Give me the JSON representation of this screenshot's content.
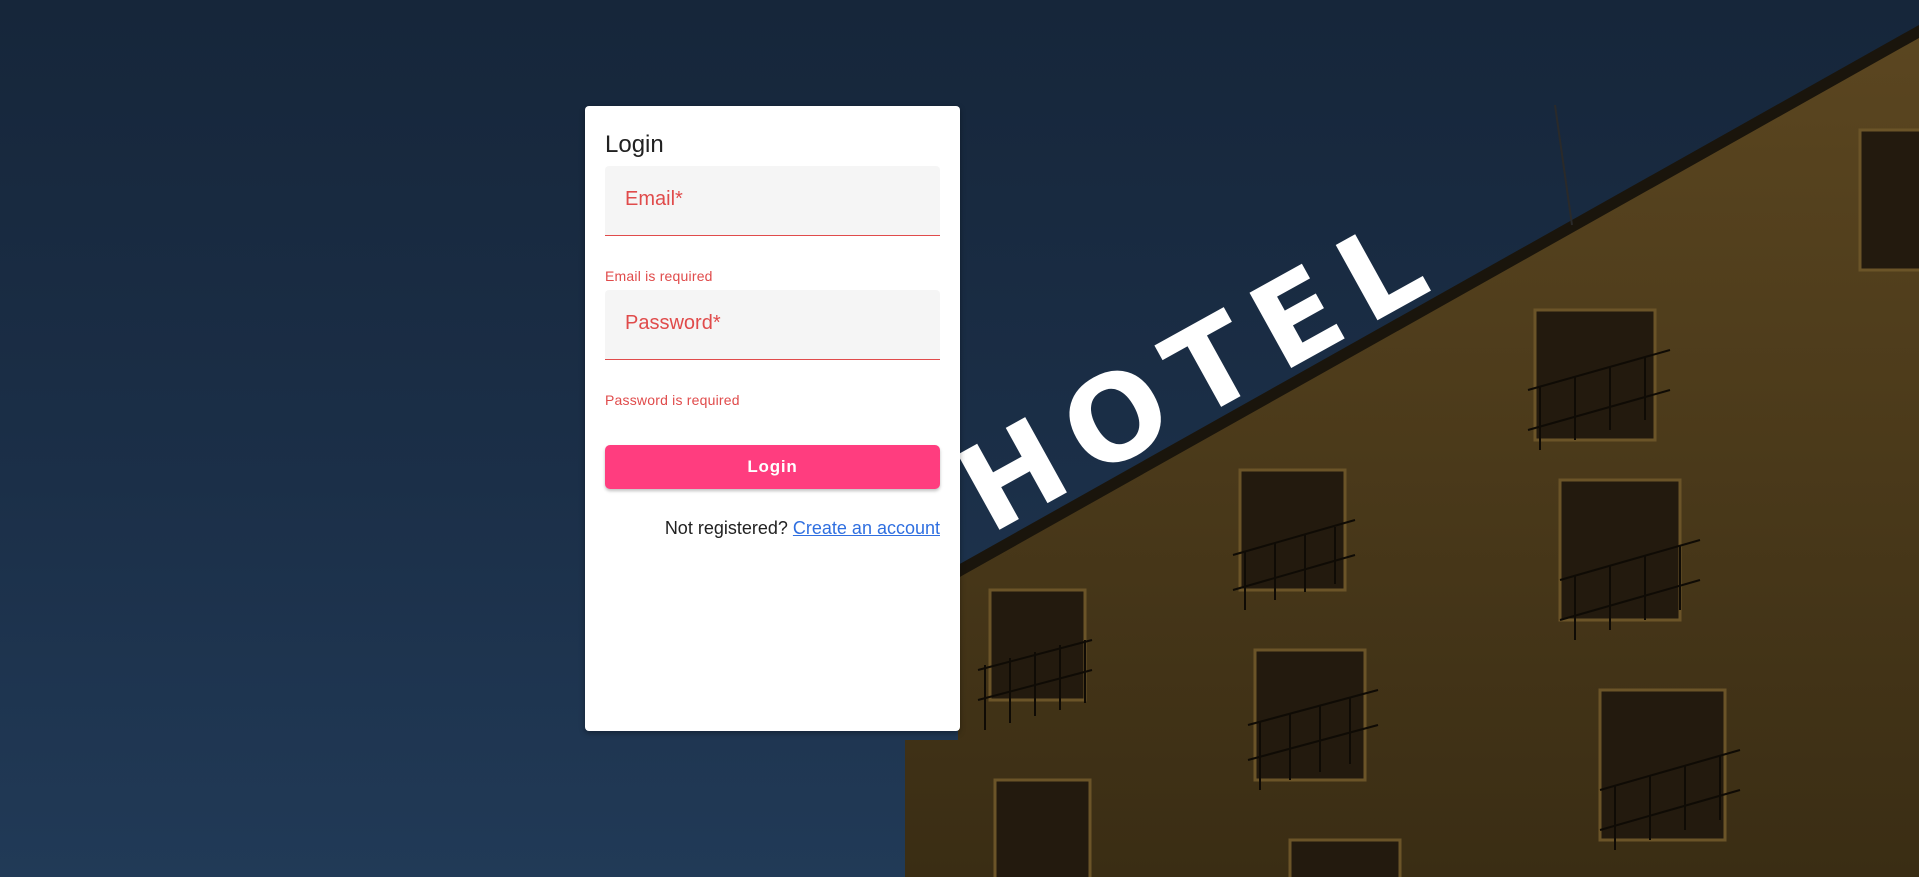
{
  "login": {
    "title": "Login",
    "email_label": "Email*",
    "email_value": "",
    "email_error": "Email is required",
    "password_label": "Password*",
    "password_value": "",
    "password_error": "Password is required",
    "submit_label": "Login",
    "register_prompt": "Not registered?",
    "register_link": "Create an account"
  },
  "background": {
    "sign_text": "HOTEL"
  },
  "colors": {
    "accent": "#ff3d7f",
    "error": "#e04b4b",
    "link": "#2f6fe0",
    "sky": "#1b2f48",
    "building": "#4a3a1a"
  },
  "icons": []
}
